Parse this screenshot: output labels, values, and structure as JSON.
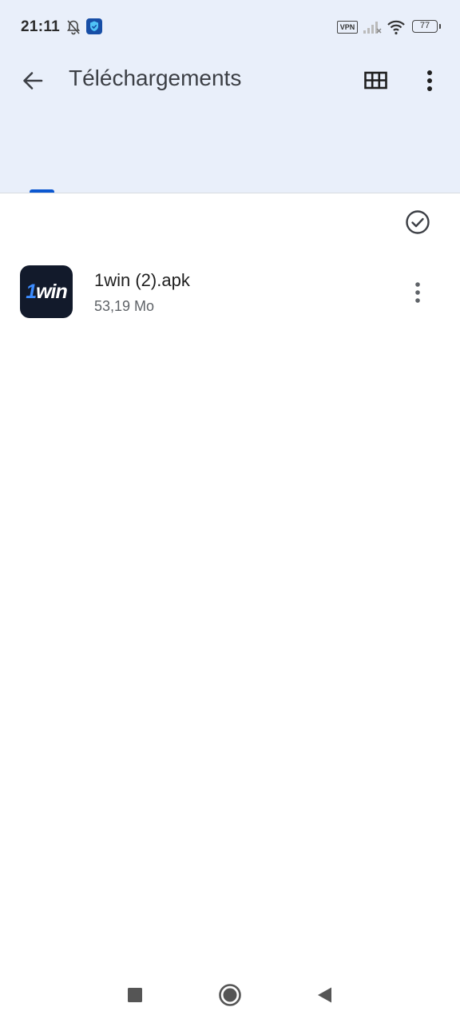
{
  "status_bar": {
    "time": "21:11",
    "vpn_label": "VPN",
    "battery_level": "77",
    "icons": [
      "bell-off-icon",
      "shield-app-icon",
      "vpn-icon",
      "signal-icon",
      "wifi-icon",
      "battery-icon"
    ]
  },
  "app_bar": {
    "title": "Téléchargements",
    "back_icon": "arrow-left-icon",
    "grid_icon": "grid-view-icon",
    "more_icon": "more-vertical-icon"
  },
  "tabs": {
    "active_indicator_color": "#0b57d0"
  },
  "list": {
    "select_icon": "check-circle-icon",
    "items": [
      {
        "name": "1win (2).apk",
        "size": "53,19 Mo",
        "icon_text_prefix": "1",
        "icon_text_suffix": "win",
        "more_icon": "more-vertical-icon"
      }
    ]
  },
  "nav_bar": {
    "icons": [
      "recents-square-icon",
      "home-circle-icon",
      "back-triangle-icon"
    ]
  },
  "colors": {
    "header_bg": "#e9effa",
    "accent": "#0b57d0",
    "app_icon_bg": "#121a2b"
  }
}
